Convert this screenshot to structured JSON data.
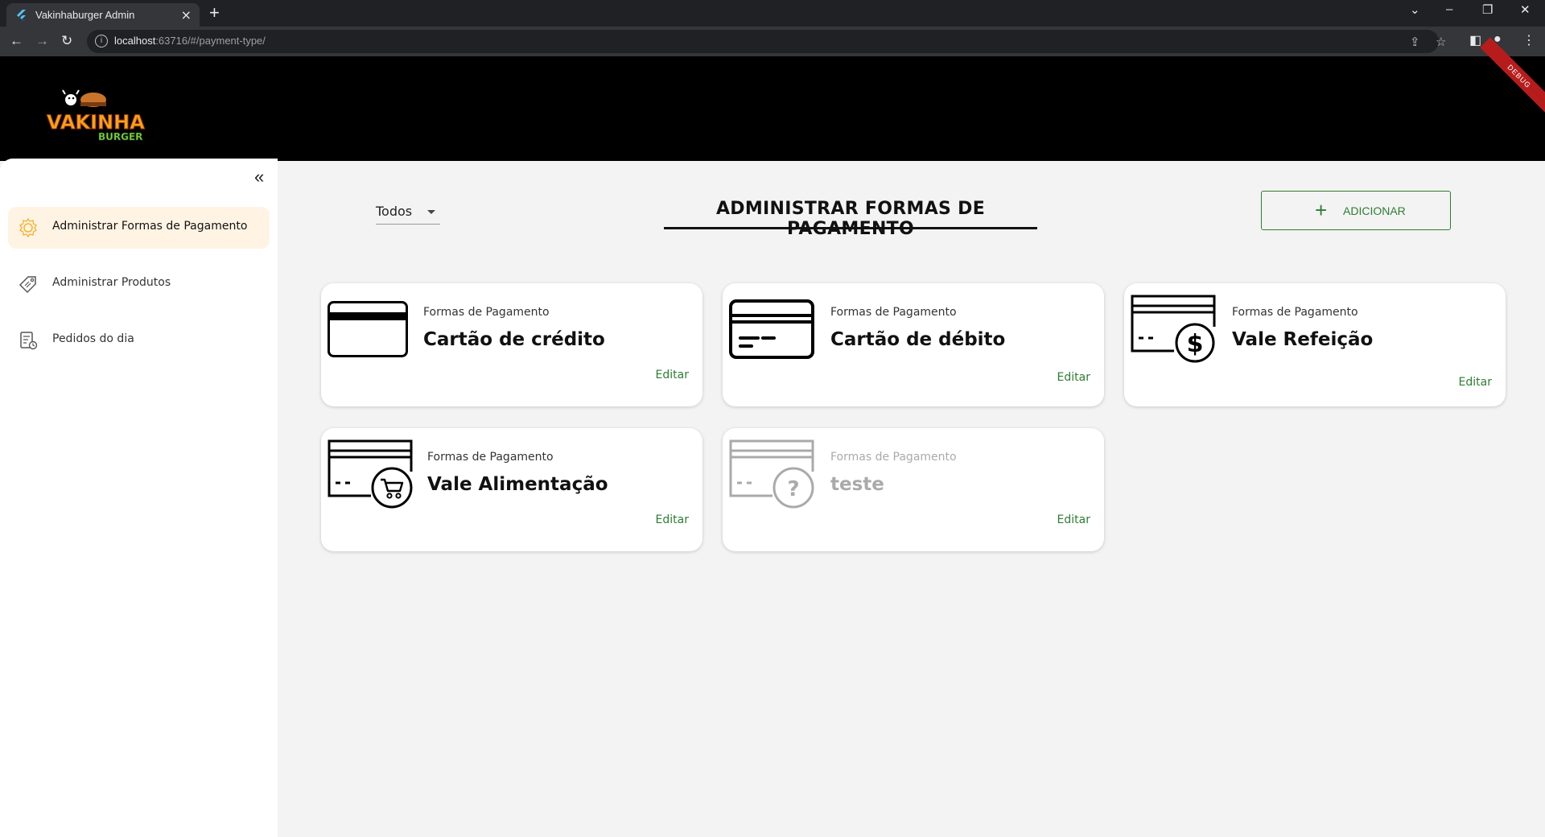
{
  "browser": {
    "tab_title": "Vakinhaburger Admin",
    "url_host": "localhost",
    "url_rest": ":63716/#/payment-type/"
  },
  "header": {
    "logo_text": "VAKINHA",
    "logo_sub": "BURGER",
    "debug_label": "DEBUG"
  },
  "sidebar": {
    "items": [
      {
        "label": "Administrar Formas de Pagamento",
        "icon": "gear-icon",
        "active": true
      },
      {
        "label": "Administrar Produtos",
        "icon": "tag-icon",
        "active": false
      },
      {
        "label": "Pedidos do dia",
        "icon": "orders-icon",
        "active": false
      }
    ]
  },
  "main": {
    "filter_value": "Todos",
    "title": "ADMINISTRAR FORMAS DE PAGAMENTO",
    "add_label": "ADICIONAR",
    "cards": [
      {
        "subtitle": "Formas de Pagamento",
        "name": "Cartão de crédito",
        "edit": "Editar",
        "icon": "credit-card-icon",
        "enabled": true
      },
      {
        "subtitle": "Formas de Pagamento",
        "name": "Cartão de débito",
        "edit": "Editar",
        "icon": "debit-card-icon",
        "enabled": true
      },
      {
        "subtitle": "Formas de Pagamento",
        "name": "Vale Refeição",
        "edit": "Editar",
        "icon": "meal-voucher-icon",
        "enabled": true
      },
      {
        "subtitle": "Formas de Pagamento",
        "name": "Vale Alimentação",
        "edit": "Editar",
        "icon": "food-voucher-icon",
        "enabled": true
      },
      {
        "subtitle": "Formas de Pagamento",
        "name": "teste",
        "edit": "Editar",
        "icon": "unknown-payment-icon",
        "enabled": false
      }
    ]
  },
  "colors": {
    "accent_green": "#2e7d32",
    "active_bg": "#fff4e4",
    "header_bg": "#000000"
  }
}
